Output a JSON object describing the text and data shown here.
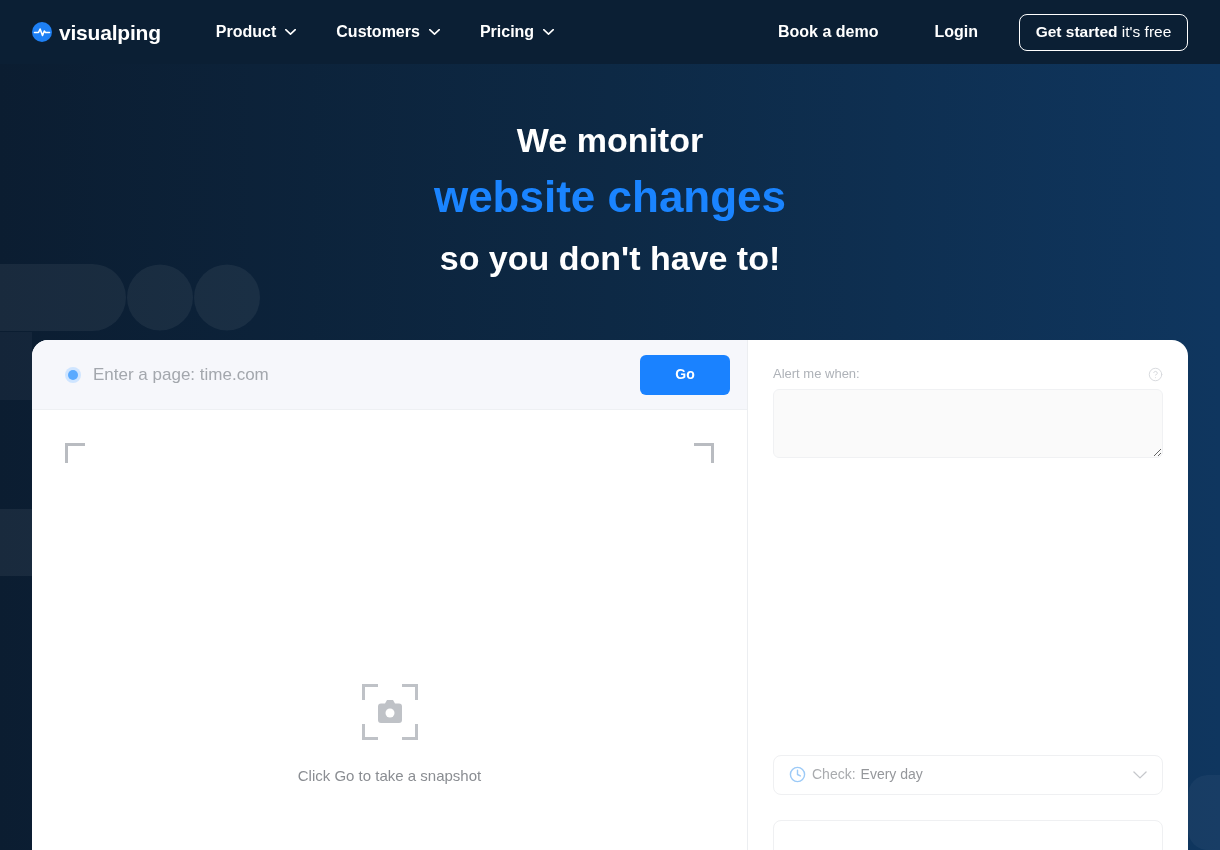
{
  "header": {
    "logo": {
      "text": "visualping"
    },
    "nav": [
      {
        "label": "Product"
      },
      {
        "label": "Customers"
      },
      {
        "label": "Pricing"
      }
    ],
    "book_demo": "Book a demo",
    "login": "Login",
    "cta": "**Get started** it's free"
  },
  "hero": {
    "line_1": "We monitor",
    "highlight": "website changes",
    "line_2": "so you don't have to!"
  },
  "monitor_card": {
    "url_field": {
      "placeholder": "Enter a page: time.com"
    },
    "go_button": "Go",
    "preview": {
      "message": "Click Go to take a snapshot"
    },
    "alert": {
      "label": "Alert me when:"
    },
    "check": {
      "label": "Check:",
      "value": "Every day"
    }
  }
}
